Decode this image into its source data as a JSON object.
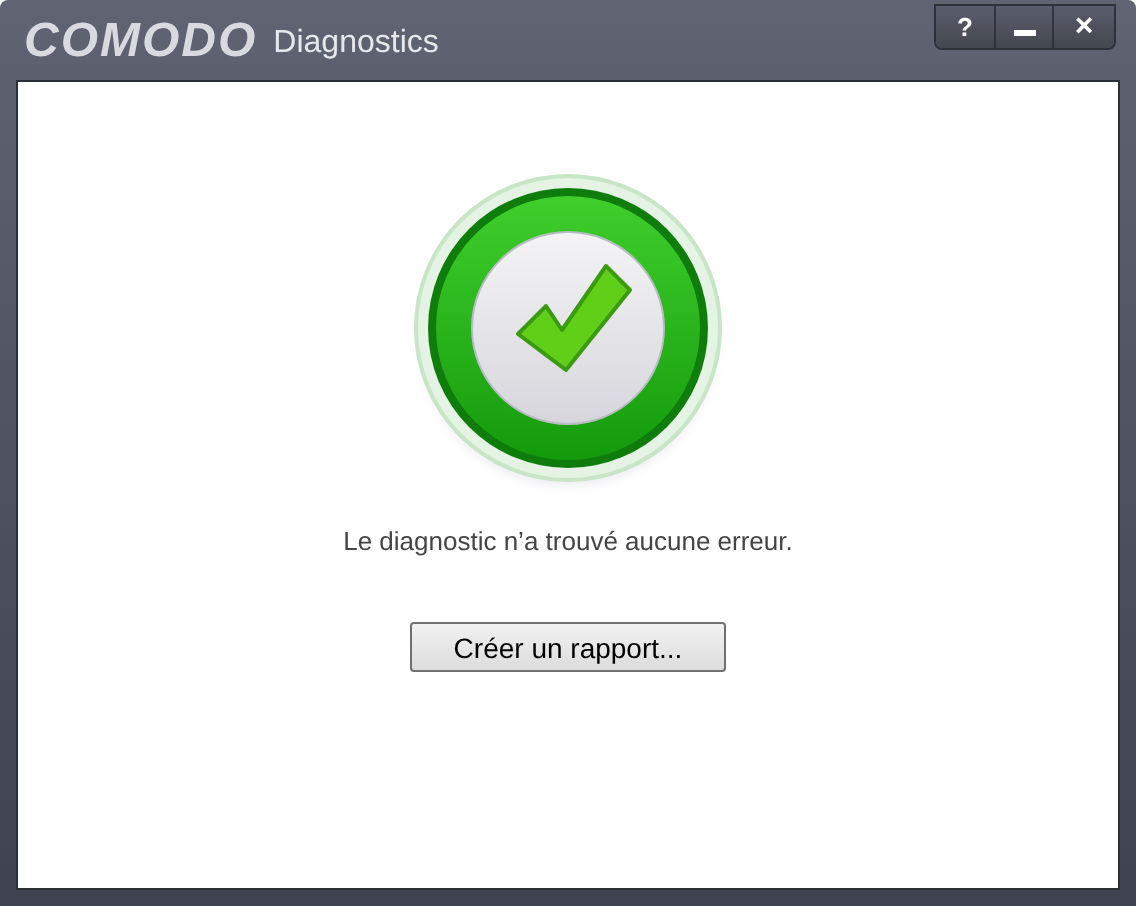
{
  "window": {
    "brand": "COMODO",
    "title": "Diagnostics",
    "help_button": "?",
    "close_button": "×"
  },
  "result": {
    "passed": true,
    "message": "Le diagnostic n’a trouvé aucune erreur."
  },
  "buttons": [
    "Créer un rapport..."
  ]
}
